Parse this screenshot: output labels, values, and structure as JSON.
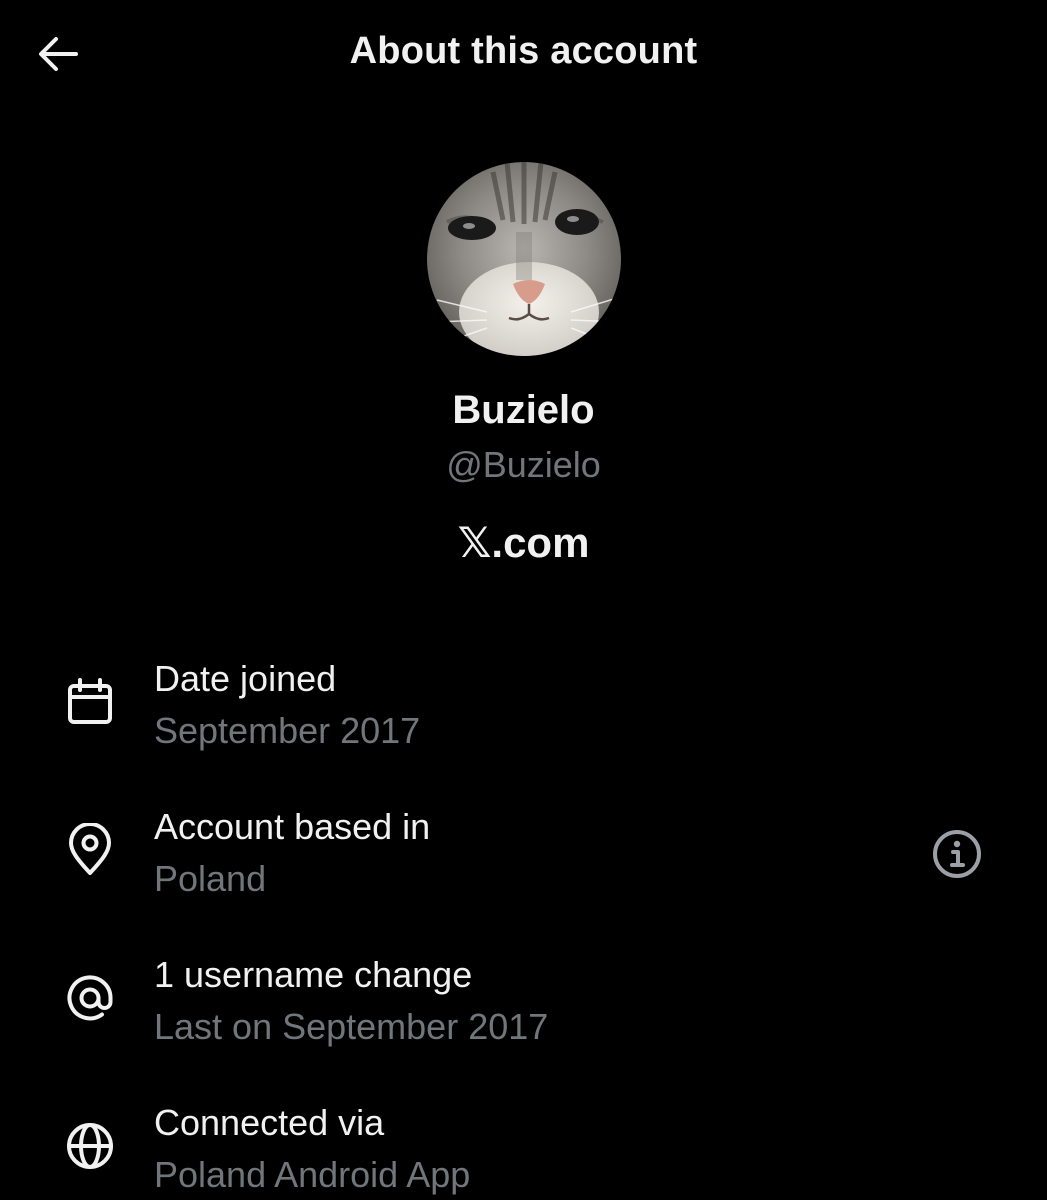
{
  "header": {
    "back_icon": "arrow-left-icon",
    "title": "About this account"
  },
  "profile": {
    "avatar_alt": "cat-face-avatar",
    "display_name": "Buzielo",
    "handle": "@Buzielo",
    "site": "𝕏.com"
  },
  "details": [
    {
      "icon": "calendar-icon",
      "title": "Date joined",
      "value": "September 2017"
    },
    {
      "icon": "location-pin-icon",
      "title": "Account based in",
      "value": "Poland",
      "info_icon": "info-icon"
    },
    {
      "icon": "at-sign-icon",
      "title": "1 username change",
      "value": "Last on September 2017"
    },
    {
      "icon": "globe-icon",
      "title": "Connected via",
      "value": "Poland Android App"
    }
  ],
  "colors": {
    "background": "#000000",
    "primary_text": "#f1f1f1",
    "secondary_text": "#71767b"
  }
}
